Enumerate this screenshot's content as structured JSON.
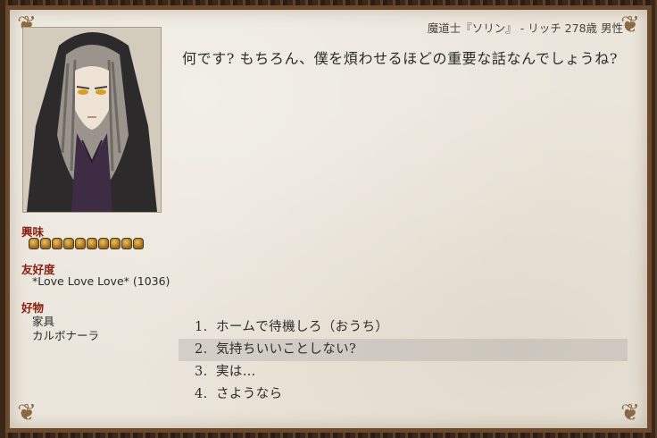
{
  "character": {
    "header": "魔道士『ソリン』 - リッチ 278歳 男性"
  },
  "speech": "何です? もちろん、僕を煩わせるほどの重要な話なんでしょうね?",
  "stats": {
    "interest_label": "興味",
    "interest_level": 10,
    "friendship_label": "友好度",
    "friendship_value": "*Love Love Love* (1036)",
    "likes_label": "好物",
    "likes": [
      "家具",
      "カルボナーラ"
    ]
  },
  "choices": [
    {
      "num": "1.",
      "label": "ホームで待機しろ（おうち）"
    },
    {
      "num": "2.",
      "label": "気持ちいいことしない?"
    },
    {
      "num": "3.",
      "label": "実は…"
    },
    {
      "num": "4.",
      "label": "さようなら"
    }
  ],
  "selected_choice": 2
}
